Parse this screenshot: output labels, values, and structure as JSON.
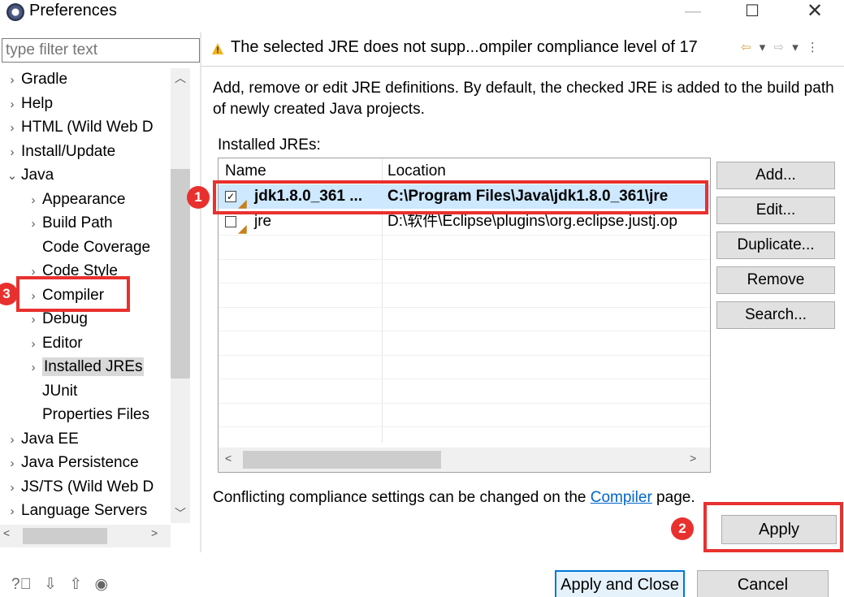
{
  "window": {
    "title": "Preferences",
    "minimize_glyph": "—",
    "maximize_glyph": "☐",
    "close_glyph": "✕"
  },
  "filter": {
    "placeholder": "type filter text"
  },
  "tree": {
    "items": [
      {
        "label": "Gradle",
        "arrow": "›",
        "level": 0
      },
      {
        "label": "Help",
        "arrow": "›",
        "level": 0
      },
      {
        "label": "HTML (Wild Web D",
        "arrow": "›",
        "level": 0
      },
      {
        "label": "Install/Update",
        "arrow": "›",
        "level": 0
      },
      {
        "label": "Java",
        "arrow": "⌄",
        "level": 0
      },
      {
        "label": "Appearance",
        "arrow": "›",
        "level": 1
      },
      {
        "label": "Build Path",
        "arrow": "›",
        "level": 1
      },
      {
        "label": "Code Coverage",
        "arrow": "",
        "level": 1
      },
      {
        "label": "Code Style",
        "arrow": "›",
        "level": 1
      },
      {
        "label": "Compiler",
        "arrow": "›",
        "level": 1
      },
      {
        "label": "Debug",
        "arrow": "›",
        "level": 1
      },
      {
        "label": "Editor",
        "arrow": "›",
        "level": 1
      },
      {
        "label": "Installed JREs",
        "arrow": "›",
        "level": 1
      },
      {
        "label": "JUnit",
        "arrow": "",
        "level": 1
      },
      {
        "label": "Properties Files",
        "arrow": "",
        "level": 1
      },
      {
        "label": "Java EE",
        "arrow": "›",
        "level": 0
      },
      {
        "label": "Java Persistence",
        "arrow": "›",
        "level": 0
      },
      {
        "label": "JS/TS (Wild Web D",
        "arrow": "›",
        "level": 0
      },
      {
        "label": "Language Servers",
        "arrow": "›",
        "level": 0
      }
    ]
  },
  "page": {
    "header_title": "The selected JRE does not supp...ompiler compliance level of 17",
    "description": "Add, remove or edit JRE definitions. By default, the checked JRE is added to the build path of newly created Java projects.",
    "installed_label": "Installed JREs:",
    "table": {
      "col_name": "Name",
      "col_location": "Location",
      "rows": [
        {
          "name": "jdk1.8.0_361 ...",
          "location": "C:\\Program Files\\Java\\jdk1.8.0_361\\jre",
          "checked": true
        },
        {
          "name": "jre",
          "location": "D:\\软件\\Eclipse\\plugins\\org.eclipse.justj.op",
          "checked": false
        }
      ]
    },
    "buttons": {
      "add": "Add...",
      "edit": "Edit...",
      "duplicate": "Duplicate...",
      "remove": "Remove",
      "search": "Search..."
    },
    "footer_prefix": "Conflicting compliance settings can be changed on the ",
    "footer_link": "Compiler",
    "footer_suffix": " page.",
    "apply": "Apply"
  },
  "bottom": {
    "apply_close": "Apply and Close",
    "cancel": "Cancel"
  },
  "annotations": {
    "one": "1",
    "two": "2",
    "three": "3"
  },
  "colors": {
    "annotation": "#e8312e",
    "selection": "#cde8ff",
    "link": "#0066cc",
    "default_button_border": "#0078d7"
  }
}
